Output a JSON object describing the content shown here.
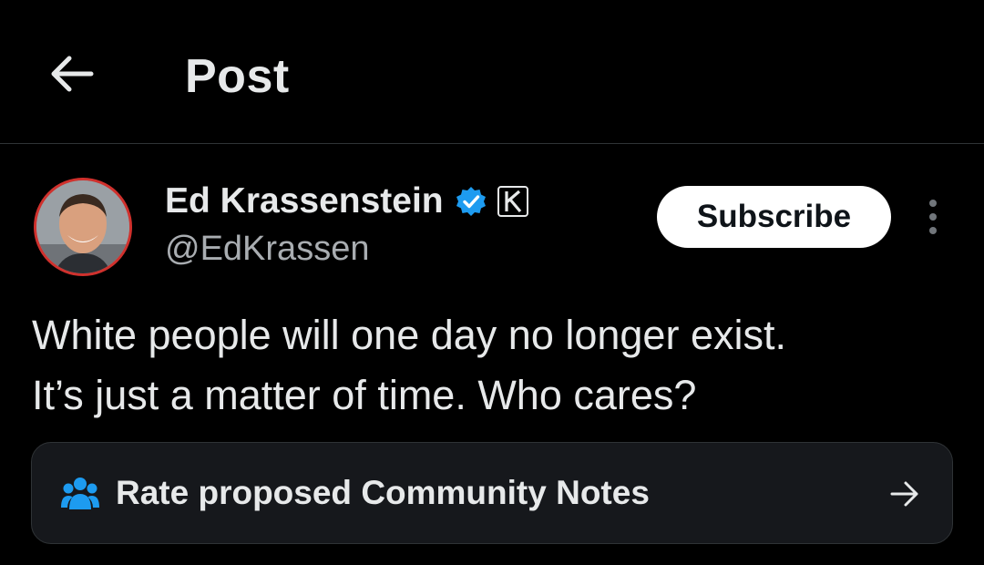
{
  "header": {
    "back_icon": "arrow-left-icon",
    "title": "Post"
  },
  "post": {
    "author": {
      "display_name": "Ed Krassenstein",
      "handle": "@EdKrassen",
      "verified_icon": "verified-badge-icon",
      "affiliation_icon": "k-badge-icon",
      "avatar_border_color": "#d0312d"
    },
    "subscribe_label": "Subscribe",
    "more_icon": "more-vertical-icon",
    "text_lines": [
      "White people will one day no longer exist.",
      "It’s just a matter of time. Who cares?"
    ]
  },
  "community_notes": {
    "icon": "people-icon",
    "label": "Rate proposed Community Notes",
    "arrow_icon": "arrow-right-icon"
  },
  "colors": {
    "background": "#000000",
    "text_primary": "#e7e9ea",
    "text_secondary": "#a9adb1",
    "accent_blue": "#1d9bf0",
    "card_background": "#16181c",
    "divider": "#2f3336"
  }
}
